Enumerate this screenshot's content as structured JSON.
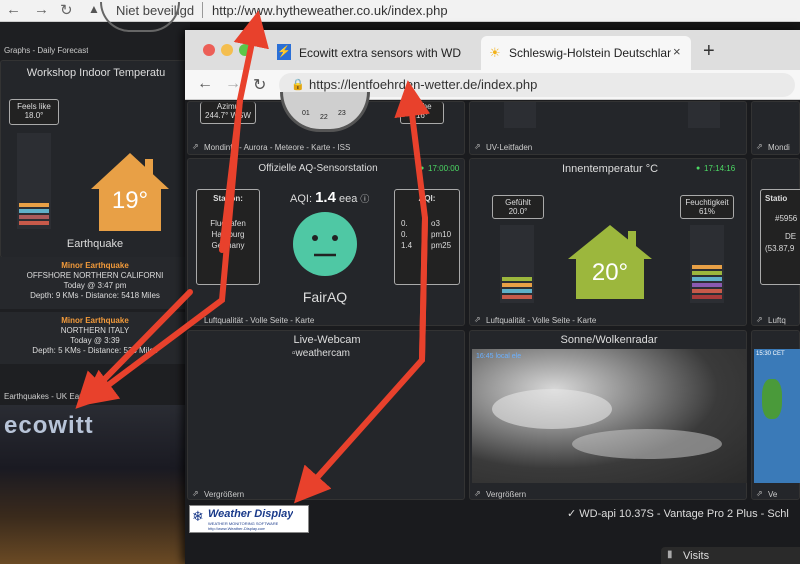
{
  "back_window": {
    "security_label": "Niet beveiligd",
    "url": "http://www.hytheweather.co.uk/index.php",
    "graphs_link": "Graphs - Daily Forecast",
    "indoor_title": "Workshop Indoor Temperatu",
    "feels_like_label": "Feels like",
    "feels_like_value": "18.0°",
    "indoor_temp": "19°",
    "earthquake_title": "Earthquake",
    "quakes": [
      {
        "mag": "Minor Earthquake",
        "place": "OFFSHORE NORTHERN CALIFORNI",
        "time": "Today @ 3:47 pm",
        "detail": "Depth: 9 KMs - Distance: 5418 Miles"
      },
      {
        "mag": "Minor Earthquake",
        "place": "NORTHERN ITALY",
        "time": "Today @ 3:39",
        "detail": "Depth: 5 KMs - Distance: 538 Miles"
      }
    ],
    "earthquakes_link": "Earthquakes - UK Earthquakes",
    "ecowitt_logo": "ecowitt",
    "colors": {
      "house_orange": "#e8a046",
      "alert_orange": "#f29a3a"
    }
  },
  "front_window": {
    "tabs": [
      {
        "title": "Ecowitt extra sensors with WD",
        "icon": "lightning-icon"
      },
      {
        "title": "Schleswig-Holstein Deutschlan",
        "icon": "sun-icon"
      }
    ],
    "new_tab": "+",
    "url": "https://lentfoehrden-wetter.de/index.php",
    "top_row": {
      "azimuth_label": "Azimu",
      "azimuth_value": "244.7° WSW",
      "hoehe_label": "Höhe",
      "hoehe_value": "16°",
      "compass_numbers": [
        "01",
        "22",
        "23"
      ],
      "link_moon": "Mondinfo - Aurora - Meteore - Karte - ISS",
      "link_uv": "UV-Leitfaden",
      "link_moon2": "Mondi"
    },
    "aq_panel": {
      "title": "Offizielle AQ-Sensorstation",
      "time": "17:00:00",
      "station_label": "Station:",
      "station_lines": [
        "Flughafen",
        "Hamburg",
        "Germany"
      ],
      "aqi_label": "AQI:",
      "aqi_value": "1.4",
      "aqi_unit": "eea",
      "aqi_right_label": "AQI:",
      "pollutants": [
        {
          "val": "0.",
          "name": "o3"
        },
        {
          "val": "0.",
          "name": "pm10"
        },
        {
          "val": "1.4",
          "name": "pm25"
        }
      ],
      "brand": "FairAQ",
      "link": "Luftqualität - Volle Seite - Karte",
      "face_color": "#4fc8a4"
    },
    "indoor_panel": {
      "title": "Innentemperatur °C",
      "time": "17:14:16",
      "feels_label": "Gefühlt",
      "feels_value": "20.0°",
      "humidity_label": "Feuchtigkeit",
      "humidity_value": "61%",
      "temp": "20°",
      "link": "Luftqualität - Volle Seite - Karte",
      "house_color": "#9cb73d"
    },
    "right_partial": {
      "station_label": "Statio",
      "id": "#5956",
      "country": "DE",
      "coords": "(53.87,9",
      "link": "Luftq"
    },
    "webcam_panel": {
      "title": "Live-Webcam",
      "image_alt": "weathercam",
      "link": "Vergrößern"
    },
    "radar_panel": {
      "title": "Sonne/Wolkenradar",
      "stamp": "16:45 local ele",
      "link": "Vergrößern",
      "right_stamp": "15:30 CET"
    },
    "right_link": "Ve",
    "footer": {
      "logo_text": "Weather Display",
      "logo_sub": "WEATHER MONITORING SOFTWARE",
      "logo_url": "http://www.Weather-Display.com",
      "status": "✓  WD-api 10.37S  -  Vantage Pro 2 Plus  -  Schl",
      "visits": "Visits"
    }
  }
}
